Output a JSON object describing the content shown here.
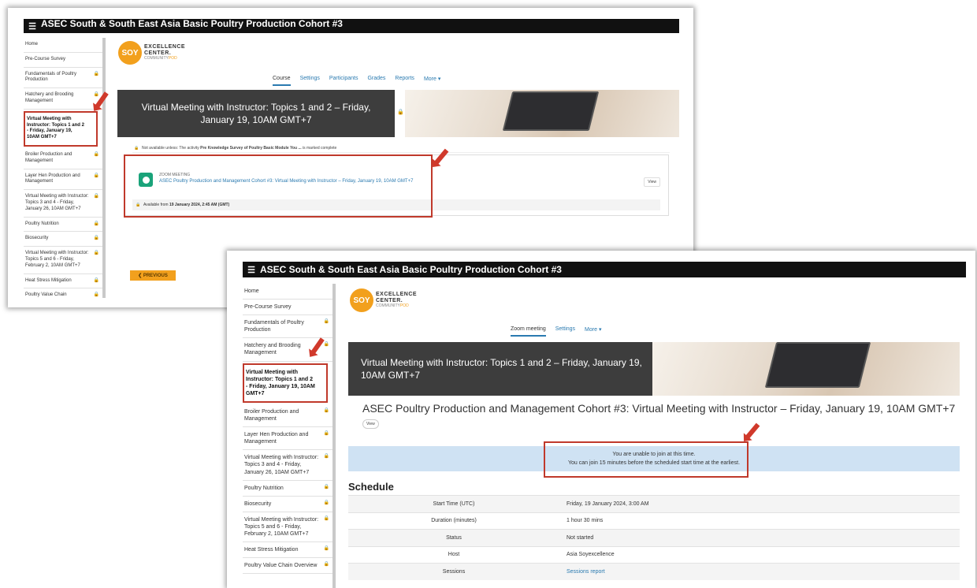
{
  "shot1": {
    "topbar_title": "ASEC South & South East Asia Basic Poultry Production Cohort #3",
    "sidebar": [
      {
        "label": "Home",
        "locked": false
      },
      {
        "label": "Pre-Course Survey",
        "locked": false
      },
      {
        "label": "Fundamentals of Poultry Production",
        "locked": true
      },
      {
        "label": "Hatchery and Brooding Management",
        "locked": true
      },
      {
        "label": "Virtual Meeting with Instructor: Topics 1 and 2 - Friday, January 19, 10AM GMT+7",
        "locked": false,
        "active": true
      },
      {
        "label": "Broiler Production and Management",
        "locked": true
      },
      {
        "label": "Layer Hen Production and Management",
        "locked": true
      },
      {
        "label": "Virtual Meeting with Instructor: Topics 3 and 4 - Friday, January 26, 10AM GMT+7",
        "locked": true
      },
      {
        "label": "Poultry Nutrition",
        "locked": true
      },
      {
        "label": "Biosecurity",
        "locked": true
      },
      {
        "label": "Virtual Meeting with Instructor: Topics 5 and 6 - Friday, February 2, 10AM GMT+7",
        "locked": true
      },
      {
        "label": "Heat Stress Mitigation",
        "locked": true
      },
      {
        "label": "Poultry Value Chain",
        "locked": true
      }
    ],
    "tabs": [
      "Course",
      "Settings",
      "Participants",
      "Grades",
      "Reports",
      "More ▾"
    ],
    "banner_title": "Virtual Meeting with Instructor: Topics 1 and 2 – Friday, January 19, 10AM GMT+7",
    "notice_prefix": "Not available unless: The activity ",
    "notice_bold": "Pre Knowledge Survey of Poultry Basic Module You ...",
    "notice_suffix": " is marked complete",
    "activity_type": "ZOOM MEETING",
    "activity_link": "ASEC Poultry Production and Management Cohort #3: Virtual Meeting with Instructor – Friday, January 19, 10AM GMT+7",
    "activity_view": "View",
    "available_prefix": "Available from ",
    "available_date": "19 January 2024, 2:45 AM (GMT)",
    "previous_label": "❮ PREVIOUS"
  },
  "shot2": {
    "topbar_title": "ASEC South & South East Asia Basic Poultry Production Cohort #3",
    "sidebar": [
      {
        "label": "Home",
        "locked": false
      },
      {
        "label": "Pre-Course Survey",
        "locked": false
      },
      {
        "label": "Fundamentals of Poultry Production",
        "locked": true
      },
      {
        "label": "Hatchery and Brooding Management",
        "locked": true
      },
      {
        "label": "Virtual Meeting with Instructor: Topics 1 and 2 - Friday, January 19, 10AM GMT+7",
        "locked": false,
        "active": true
      },
      {
        "label": "Broiler Production and Management",
        "locked": true
      },
      {
        "label": "Layer Hen Production and Management",
        "locked": true
      },
      {
        "label": "Virtual Meeting with Instructor: Topics 3 and 4 - Friday, January 26, 10AM GMT+7",
        "locked": true
      },
      {
        "label": "Poultry Nutrition",
        "locked": true
      },
      {
        "label": "Biosecurity",
        "locked": true
      },
      {
        "label": "Virtual Meeting with Instructor: Topics 5 and 6 - Friday, February 2, 10AM GMT+7",
        "locked": true
      },
      {
        "label": "Heat Stress Mitigation",
        "locked": true
      },
      {
        "label": "Poultry Value Chain Overview",
        "locked": true
      }
    ],
    "tabs": [
      "Zoom meeting",
      "Settings",
      "More ▾"
    ],
    "banner_title": "Virtual Meeting with Instructor: Topics 1 and 2 – Friday, January 19, 10AM GMT+7",
    "page_title": "ASEC Poultry Production and Management Cohort #3: Virtual Meeting with Instructor – Friday, January 19, 10AM GMT+7",
    "view_label": "View",
    "alert_line1": "You are unable to join at this time.",
    "alert_line2": "You can join 15 minutes before the scheduled start time at the earliest.",
    "schedule_heading": "Schedule",
    "schedule": [
      {
        "key": "Start Time (UTC)",
        "value": "Friday, 19 January 2024, 3:00 AM"
      },
      {
        "key": "Duration (minutes)",
        "value": "1 hour 30 mins"
      },
      {
        "key": "Status",
        "value": "Not started"
      },
      {
        "key": "Host",
        "value": "Asia Soyexcellence"
      },
      {
        "key": "Sessions",
        "value": "Sessions report",
        "link": true
      }
    ]
  },
  "logo": {
    "circle": "SOY",
    "line1": "EXCELLENCE",
    "line2": "CENTER.",
    "line3": "COMMUNITY",
    "line3b": "POD"
  },
  "colors": {
    "highlight": "#c0392b",
    "accent": "#2a7ab0",
    "brand_orange": "#f2a01d",
    "banner_bg": "#3d3d3d",
    "alert_bg": "#cfe2f3"
  }
}
